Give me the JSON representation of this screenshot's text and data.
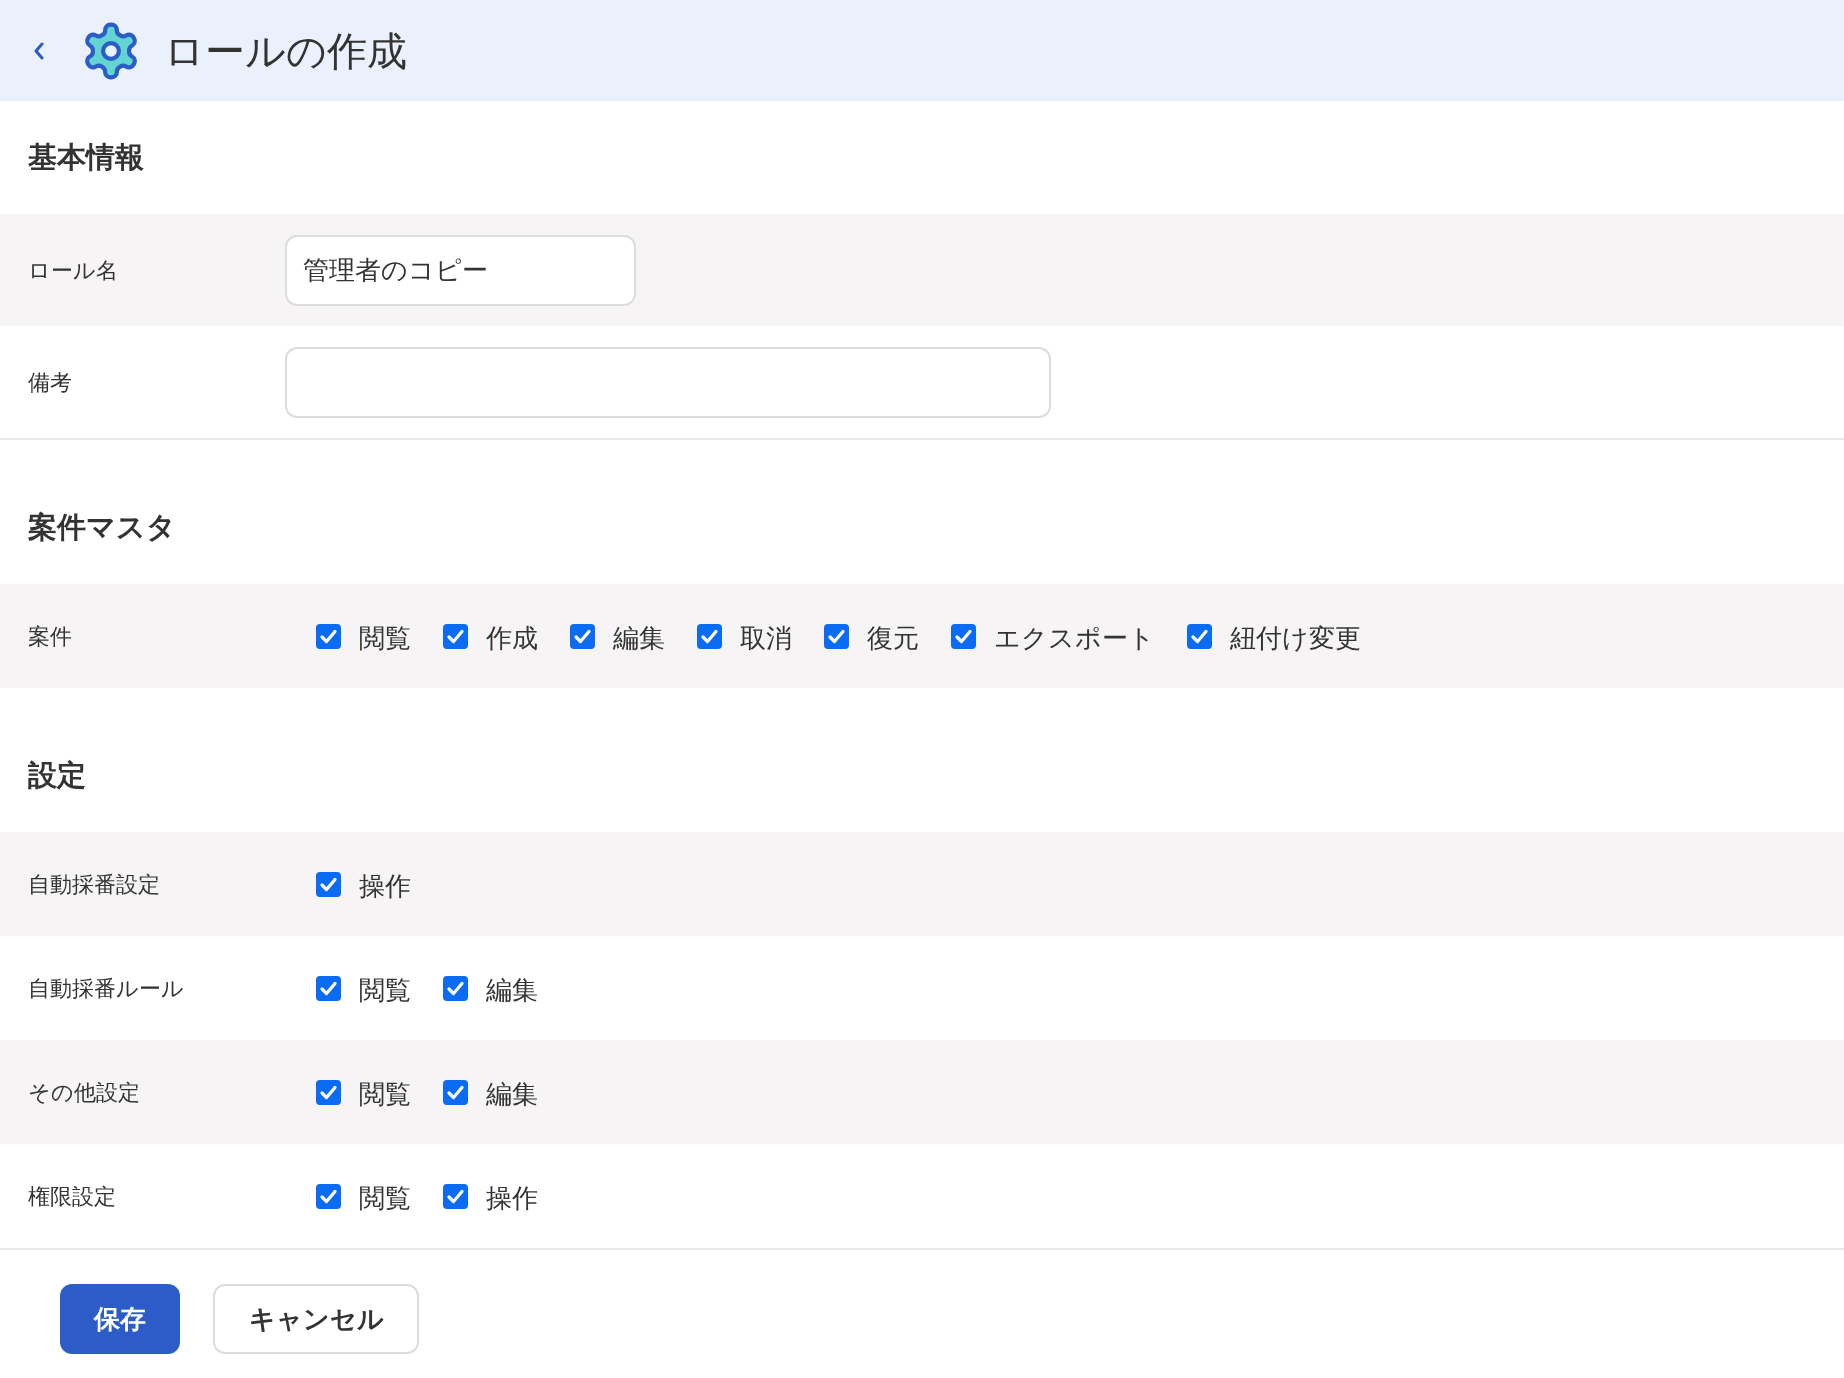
{
  "header": {
    "title": "ロールの作成"
  },
  "sections": [
    {
      "title": "基本情報",
      "rows": [
        {
          "kind": "text",
          "label": "ロール名",
          "value": "管理者のコピー"
        },
        {
          "kind": "memo",
          "label": "備考"
        }
      ]
    },
    {
      "title": "案件マスタ",
      "rows": [
        {
          "kind": "checkboxes",
          "label": "案件",
          "options": [
            {
              "label": "閲覧",
              "checked": true
            },
            {
              "label": "作成",
              "checked": true
            },
            {
              "label": "編集",
              "checked": true
            },
            {
              "label": "取消",
              "checked": true
            },
            {
              "label": "復元",
              "checked": true
            },
            {
              "label": "エクスポート",
              "checked": true
            },
            {
              "label": "紐付け変更",
              "checked": true
            }
          ]
        }
      ]
    },
    {
      "title": "設定",
      "rows": [
        {
          "kind": "checkboxes",
          "label": "自動採番設定",
          "options": [
            {
              "label": "操作",
              "checked": true
            }
          ]
        },
        {
          "kind": "checkboxes",
          "label": "自動採番ルール",
          "options": [
            {
              "label": "閲覧",
              "checked": true
            },
            {
              "label": "編集",
              "checked": true
            }
          ]
        },
        {
          "kind": "checkboxes",
          "label": "その他設定",
          "options": [
            {
              "label": "閲覧",
              "checked": true
            },
            {
              "label": "編集",
              "checked": true
            }
          ]
        },
        {
          "kind": "checkboxes",
          "label": "権限設定",
          "options": [
            {
              "label": "閲覧",
              "checked": true
            },
            {
              "label": "操作",
              "checked": true
            }
          ]
        }
      ]
    }
  ],
  "buttons": [
    {
      "kind": "primary",
      "label": "保存"
    },
    {
      "kind": "secondary",
      "label": "キャンセル"
    }
  ]
}
